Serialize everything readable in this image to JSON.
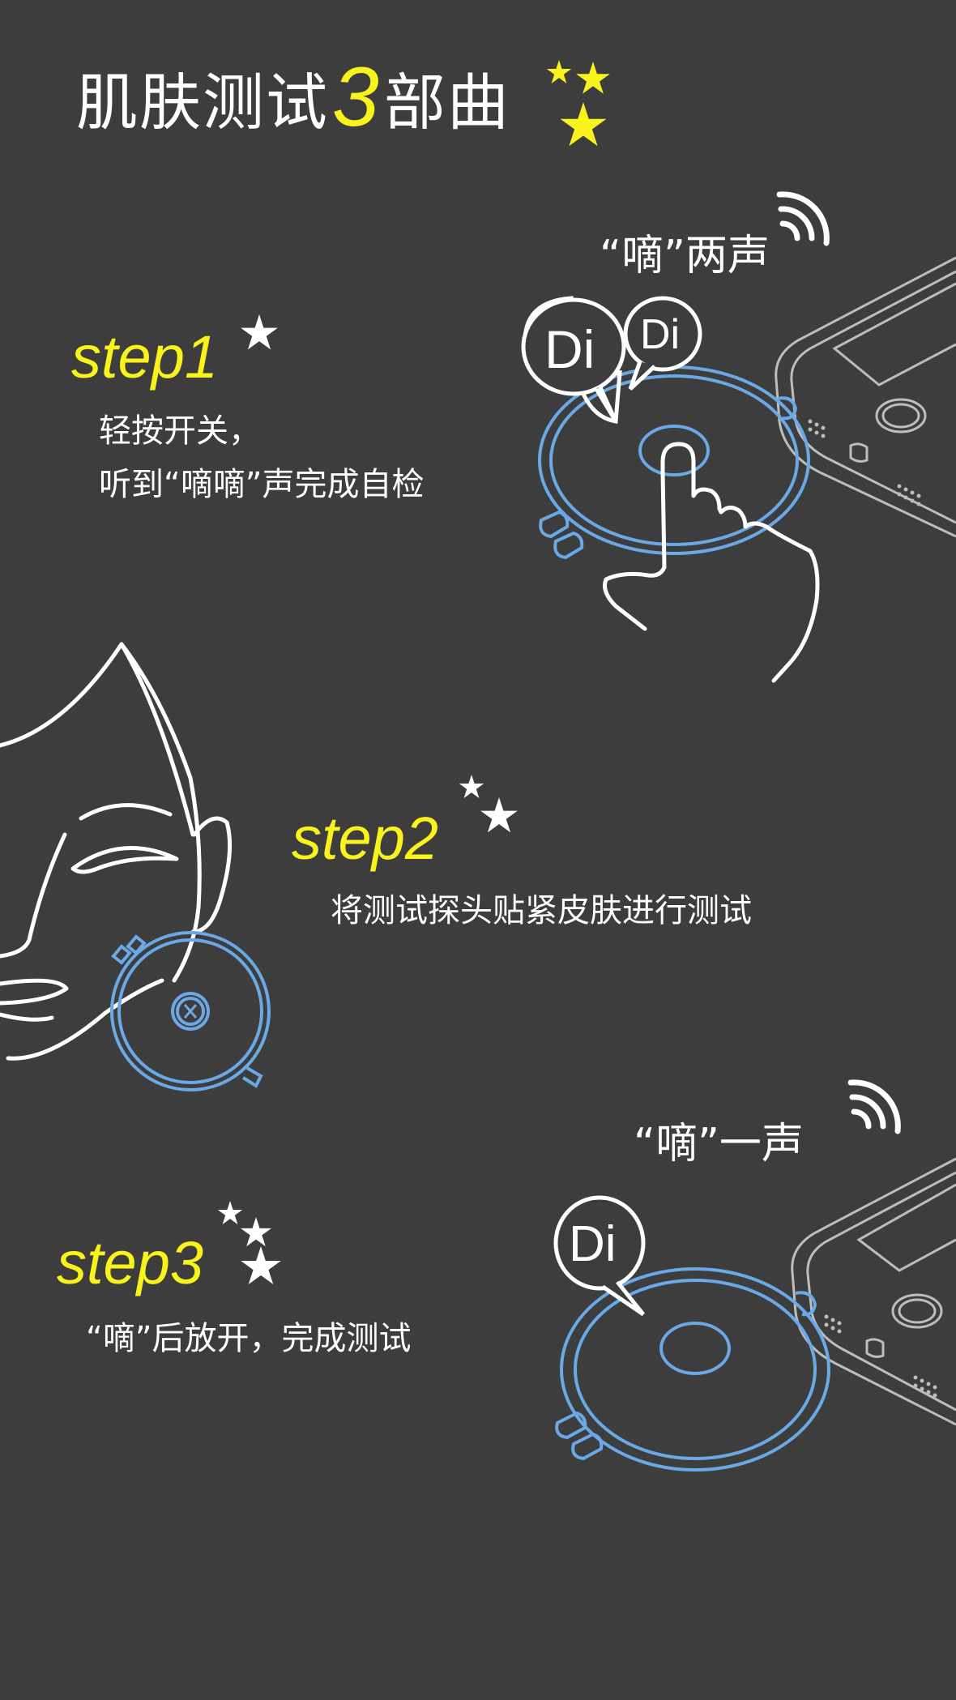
{
  "title": {
    "prefix": "肌肤测试",
    "number": "3",
    "suffix": "部曲"
  },
  "step1": {
    "label": "step1",
    "line1": "轻按开关，",
    "line2": "听到“嘀嘀”声完成自检",
    "beep_label": "“嘀”两声",
    "bubble1": "Di",
    "bubble2": "Di"
  },
  "step2": {
    "label": "step2",
    "line1": "将测试探头贴紧皮肤进行测试"
  },
  "step3": {
    "label": "step3",
    "line1": "“嘀”后放开，完成测试",
    "beep_label": "“嘀”一声",
    "bubble1": "Di"
  },
  "colors": {
    "background": "#3d3d3d",
    "accent_yellow": "#f8f21d",
    "device_blue": "#6aa8e6",
    "line_white": "#ffffff",
    "phone_gray": "#bdbdbd"
  },
  "icons": [
    "star-icon",
    "sound-wave-icon",
    "phone-illustration",
    "device-illustration",
    "hand-illustration",
    "face-illustration"
  ]
}
